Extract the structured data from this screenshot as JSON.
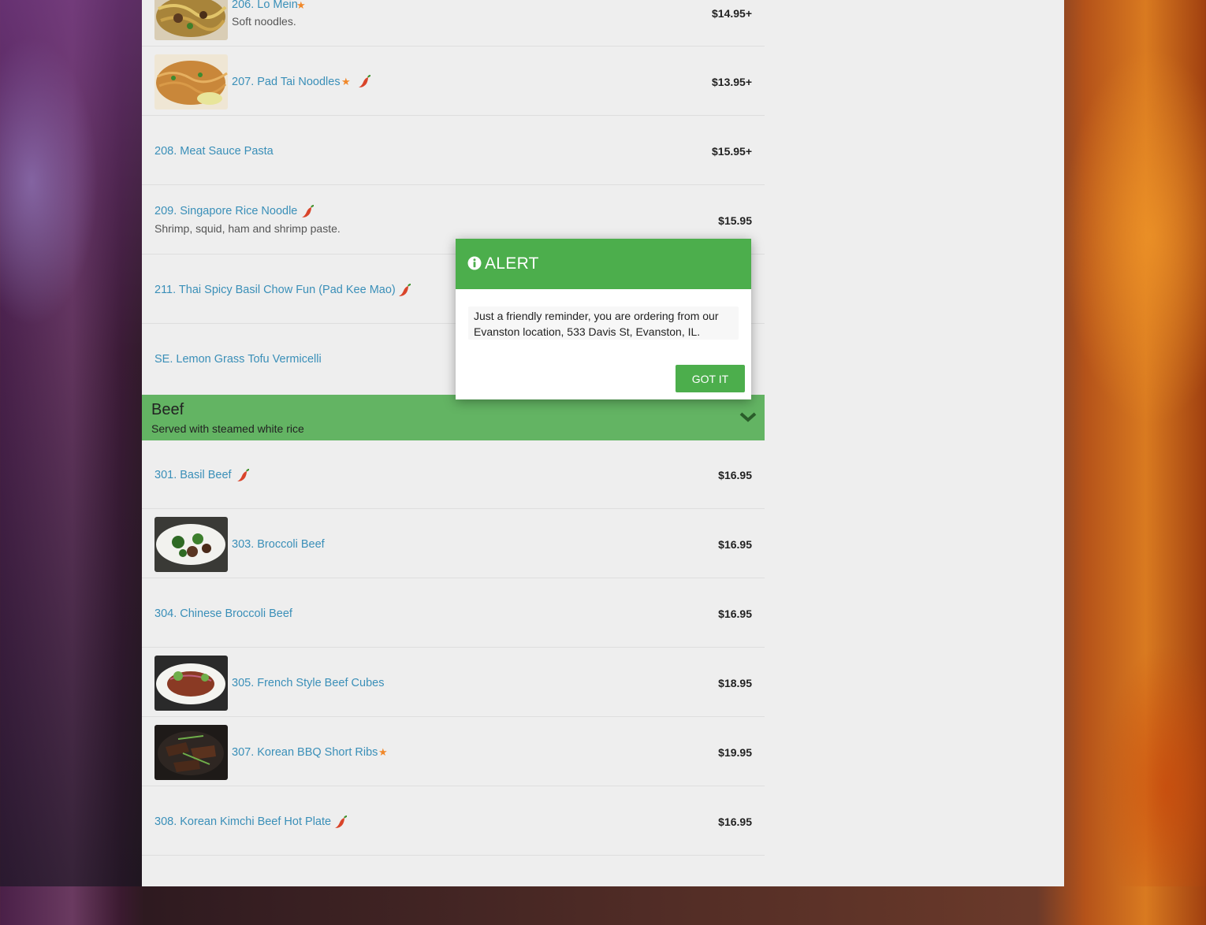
{
  "menu_items": [
    {
      "name": "206. Lo Mein",
      "desc": "Soft noodles.",
      "price": "$14.95+",
      "star": true,
      "spicy": false,
      "thumb": "lo-mein-photo"
    },
    {
      "name": "207. Pad Tai Noodles",
      "desc": "",
      "price": "$13.95+",
      "star": true,
      "spicy": true,
      "thumb": "pad-tai-photo"
    },
    {
      "name": "208. Meat Sauce Pasta",
      "desc": "",
      "price": "$15.95+",
      "star": false,
      "spicy": false
    },
    {
      "name": "209. Singapore Rice Noodle",
      "desc": "Shrimp, squid, ham and shrimp paste.",
      "price": "$15.95",
      "star": false,
      "spicy": true
    },
    {
      "name": "211. Thai Spicy Basil Chow Fun (Pad Kee Mao)",
      "desc": "",
      "price": "",
      "star": false,
      "spicy": true
    },
    {
      "name": "SE. Lemon Grass Tofu Vermicelli",
      "desc": "",
      "price": "",
      "star": false,
      "spicy": false
    }
  ],
  "category": {
    "title": "Beef",
    "subtitle": "Served with steamed white rice",
    "color": "#63b463"
  },
  "beef_items": [
    {
      "name": "301. Basil Beef",
      "price": "$16.95",
      "star": false,
      "spicy": true
    },
    {
      "name": "303. Broccoli Beef",
      "price": "$16.95",
      "star": false,
      "spicy": false,
      "thumb": "broccoli-beef-photo"
    },
    {
      "name": "304. Chinese Broccoli Beef",
      "price": "$16.95",
      "star": false,
      "spicy": false
    },
    {
      "name": "305. French Style Beef Cubes",
      "price": "$18.95",
      "star": false,
      "spicy": false,
      "thumb": "beef-cubes-photo"
    },
    {
      "name": "307. Korean BBQ Short Ribs",
      "price": "$19.95",
      "star": true,
      "spicy": false,
      "thumb": "short-ribs-photo"
    },
    {
      "name": "308. Korean Kimchi Beef Hot Plate",
      "price": "$16.95",
      "star": false,
      "spicy": true
    }
  ],
  "modal": {
    "title": "ALERT",
    "icon": "info-circle-icon",
    "message": "Just a friendly reminder, you are ordering from our Evanston location, 533 Davis St, Evanston, IL.",
    "button_label": "Got it",
    "header_color": "#4cae4c"
  }
}
